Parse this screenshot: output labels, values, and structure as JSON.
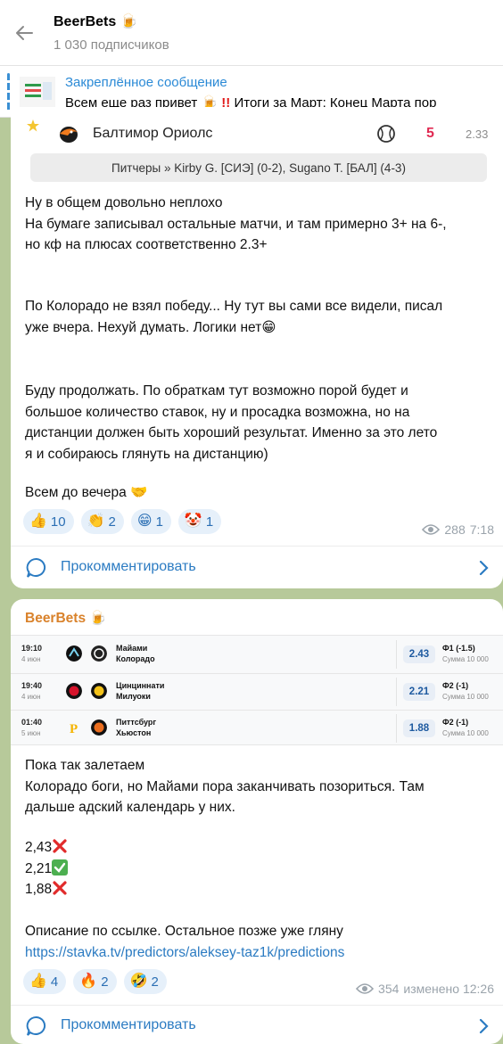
{
  "header": {
    "title": "BeerBets 🍺",
    "subscribers": "1 030 подписчиков"
  },
  "pinned": {
    "title": "Закреплённое сообщение",
    "text_a": "Всем еще раз привет 🍺 ",
    "text_b": "!!",
    "text_c": " Итоги за Март: Конец Марта пор"
  },
  "post1": {
    "match": {
      "team": "Балтимор Ориолс",
      "score": "5",
      "odd": "2.33"
    },
    "pitchers": "Питчеры » Kirby G. [СИЭ] (0-2), Sugano T. [БАЛ] (4-3)",
    "lines": [
      "Ну в общем довольно неплохо",
      "На бумаге записывал остальные матчи, и там примерно 3+ на 6-,",
      "но кф на плюсах соответственно 2.3+",
      "По Колорадо не взял победу... Ну тут вы сами все видели, писал",
      "уже вчера. Нехуй думать. Логики нет😁",
      "Буду продолжать. По обраткам тут возможно порой будет и",
      "большое количество ставок, ну и просадка возможна, но на",
      "дистанции должен быть хороший результат. Именно за это лето",
      "я и собираюсь глянуть на дистанцию)",
      "Всем до вечера 🤝"
    ],
    "reactions": [
      {
        "emoji": "👍",
        "count": "10"
      },
      {
        "emoji": "👏",
        "count": "2"
      },
      {
        "emoji": "😁",
        "count": "1"
      },
      {
        "emoji": "🤡",
        "count": "1"
      }
    ],
    "views": "288",
    "time": "7:18",
    "comment_label": "Прокомментировать"
  },
  "post2": {
    "sender": "BeerBets 🍺",
    "bets": [
      {
        "time": "19:10",
        "date": "4 июн",
        "team1": "Майами",
        "team2": "Колорадо",
        "odd": "2.43",
        "type": "Ф1 (-1.5)",
        "sum": "Сумма 10 000"
      },
      {
        "time": "19:40",
        "date": "4 июн",
        "team1": "Цинциннати",
        "team2": "Милуоки",
        "odd": "2.21",
        "type": "Ф2 (-1)",
        "sum": "Сумма 10 000"
      },
      {
        "time": "01:40",
        "date": "5 июн",
        "team1": "Питтсбург",
        "team2": "Хьюстон",
        "odd": "1.88",
        "type": "Ф2 (-1)",
        "sum": "Сумма 10 000"
      }
    ],
    "lines": [
      "Пока так залетаем",
      "Колорадо боги, но Майами пора заканчивать позориться. Там",
      "дальше адский календарь у них.",
      "2,43",
      "2,21",
      "1,88",
      "Описание по ссылке. Остальное позже уже гляну",
      "https://stavka.tv/predictors/aleksey-taz1k/predictions"
    ],
    "reactions": [
      {
        "emoji": "👍",
        "count": "4"
      },
      {
        "emoji": "🔥",
        "count": "2"
      },
      {
        "emoji": "🤣",
        "count": "2"
      }
    ],
    "views": "354",
    "time": "изменено 12:26",
    "comment_label": "Прокомментировать"
  },
  "colors": {
    "accent": "#2b7bc2",
    "sender": "#d9822b",
    "background": "#b7c99a"
  }
}
